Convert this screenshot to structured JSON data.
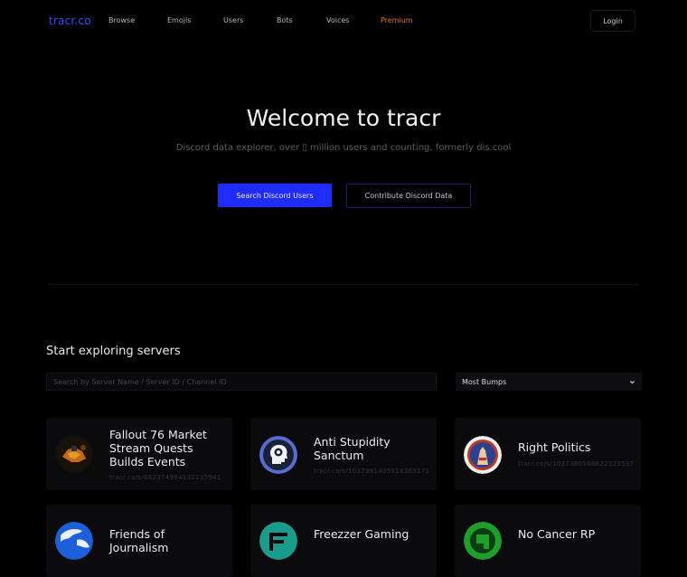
{
  "nav": {
    "logo": "tracr.co",
    "items": [
      "Browse",
      "Emojis",
      "Users",
      "Bots",
      "Voices",
      "Premium"
    ],
    "login": "Login"
  },
  "hero": {
    "title": "Welcome to tracr",
    "subtitle": "Discord data explorer, over ▯ million users and counting, formerly dis.cool",
    "primary_button": "Search Discord Users",
    "secondary_button": "Contribute Discord Data"
  },
  "servers": {
    "section_title": "Start exploring servers",
    "search_placeholder": "Search by Server Name / Server ID / Channel ID",
    "sort_selected": "Most Bumps",
    "cards": [
      {
        "name": "Fallout 76 Market Stream Quests Builds Events",
        "code": "tracr.co/s/682374984132235941"
      },
      {
        "name": "Anti Stupidity Sanctum",
        "code": "tracr.co/s/1037981405818369171"
      },
      {
        "name": "Right Politics",
        "code": "tracr.co/s/1037380568822123537"
      },
      {
        "name": "Friends of Journalism",
        "code": ""
      },
      {
        "name": "Freezzer Gaming",
        "code": ""
      },
      {
        "name": "No Cancer RP",
        "code": ""
      }
    ]
  },
  "colors": {
    "accent": "#1f2bff",
    "logo": "#3b4cff",
    "premium": "#e27a1a",
    "background": "#000000"
  }
}
